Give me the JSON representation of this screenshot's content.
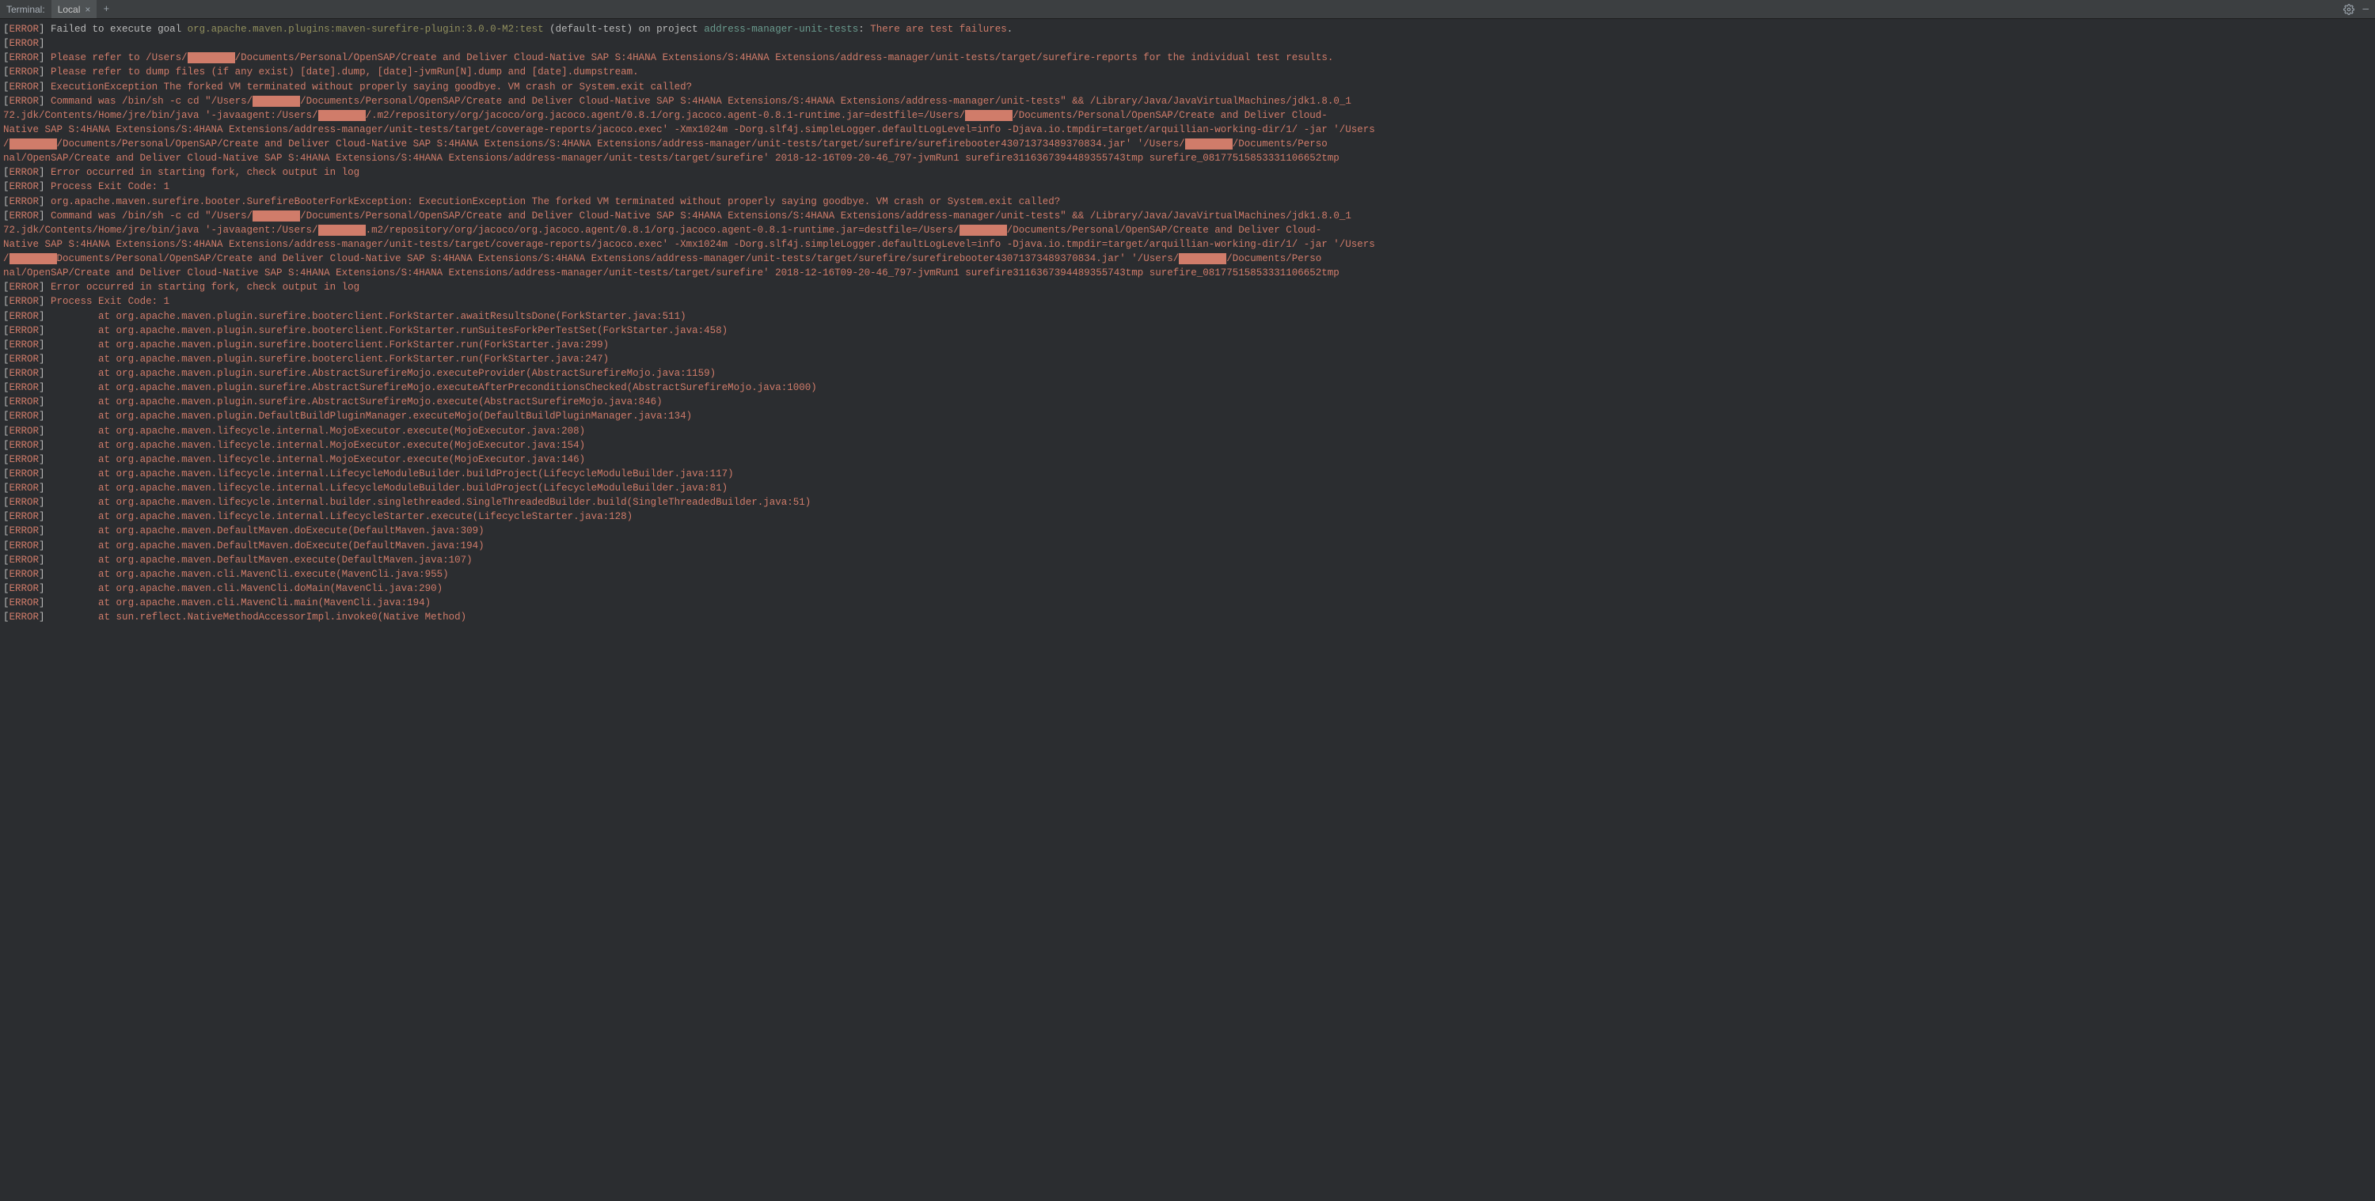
{
  "header": {
    "title": "Terminal:",
    "tab_label": "Local",
    "close_glyph": "×",
    "plus_glyph": "+",
    "gear_glyph": "⚙",
    "minimize_glyph": "—"
  },
  "error_tag": "ERROR",
  "redacted": "████████",
  "lines": [
    {
      "type": "mixed_goal",
      "pre": "Failed to execute goal ",
      "goal": "org.apache.maven.plugins:maven-surefire-plugin:3.0.0-M2:test",
      "mid": " (default-test) on project ",
      "project": "address-manager-unit-tests",
      "post1": ": ",
      "fail": "There are test failures",
      "dot": "."
    },
    {
      "type": "blank_error"
    },
    {
      "type": "refer_path",
      "pre": "Please refer to /Users/",
      "post": "/Documents/Personal/OpenSAP/Create and Deliver Cloud-Native SAP S:4HANA Extensions/S:4HANA Extensions/address-manager/unit-tests/target/surefire-reports for the individual test results."
    },
    {
      "type": "salmon_plain",
      "text": "Please refer to dump files (if any exist) [date].dump, [date]-jvmRun[N].dump and [date].dumpstream."
    },
    {
      "type": "salmon_plain",
      "text": "ExecutionException The forked VM terminated without properly saying goodbye. VM crash or System.exit called?"
    },
    {
      "type": "command_block",
      "part0_pre": "Command was /bin/sh -c cd \"/Users/",
      "part0_post": "/Documents/Personal/OpenSAP/Create and Deliver Cloud-Native SAP S:4HANA Extensions/S:4HANA Extensions/address-manager/unit-tests\" && /Library/Java/JavaVirtualMachines/jdk1.8.0_1",
      "part1_pre": "72.jdk/Contents/Home/jre/bin/java '-javaagent:/Users/",
      "part1_mid": "/.m2/repository/org/jacoco/org.jacoco.agent/0.8.1/org.jacoco.agent-0.8.1-runtime.jar=destfile=/Users/",
      "part1_post": "/Documents/Personal/OpenSAP/Create and Deliver Cloud-",
      "part2": "Native SAP S:4HANA Extensions/S:4HANA Extensions/address-manager/unit-tests/target/coverage-reports/jacoco.exec' -Xmx1024m -Dorg.slf4j.simpleLogger.defaultLogLevel=info -Djava.io.tmpdir=target/arquillian-working-dir/1/ -jar '/Users",
      "part3_pre": "/",
      "part3_mid": "/Documents/Personal/OpenSAP/Create and Deliver Cloud-Native SAP S:4HANA Extensions/S:4HANA Extensions/address-manager/unit-tests/target/surefire/surefirebooter43071373489370834.jar' '/Users/",
      "part3_post": "/Documents/Perso",
      "part4": "nal/OpenSAP/Create and Deliver Cloud-Native SAP S:4HANA Extensions/S:4HANA Extensions/address-manager/unit-tests/target/surefire' 2018-12-16T09-20-46_797-jvmRun1 surefire3116367394489355743tmp surefire_08177515853331106652tmp"
    },
    {
      "type": "salmon_plain",
      "text": "Error occurred in starting fork, check output in log"
    },
    {
      "type": "salmon_plain",
      "text": "Process Exit Code: 1"
    },
    {
      "type": "salmon_plain",
      "text": "org.apache.maven.surefire.booter.SurefireBooterForkException: ExecutionException The forked VM terminated without properly saying goodbye. VM crash or System.exit called?"
    },
    {
      "type": "command_block",
      "part0_pre": "Command was /bin/sh -c cd \"/Users/",
      "part0_post": "/Documents/Personal/OpenSAP/Create and Deliver Cloud-Native SAP S:4HANA Extensions/S:4HANA Extensions/address-manager/unit-tests\" && /Library/Java/JavaVirtualMachines/jdk1.8.0_1",
      "part1_pre": "72.jdk/Contents/Home/jre/bin/java '-javaagent:/Users/",
      "part1_mid": ".m2/repository/org/jacoco/org.jacoco.agent/0.8.1/org.jacoco.agent-0.8.1-runtime.jar=destfile=/Users/",
      "part1_post": "/Documents/Personal/OpenSAP/Create and Deliver Cloud-",
      "part2": "Native SAP S:4HANA Extensions/S:4HANA Extensions/address-manager/unit-tests/target/coverage-reports/jacoco.exec' -Xmx1024m -Dorg.slf4j.simpleLogger.defaultLogLevel=info -Djava.io.tmpdir=target/arquillian-working-dir/1/ -jar '/Users",
      "part3_pre": "/",
      "part3_mid": "Documents/Personal/OpenSAP/Create and Deliver Cloud-Native SAP S:4HANA Extensions/S:4HANA Extensions/address-manager/unit-tests/target/surefire/surefirebooter43071373489370834.jar' '/Users/",
      "part3_post": "/Documents/Perso",
      "part4": "nal/OpenSAP/Create and Deliver Cloud-Native SAP S:4HANA Extensions/S:4HANA Extensions/address-manager/unit-tests/target/surefire' 2018-12-16T09-20-46_797-jvmRun1 surefire3116367394489355743tmp surefire_08177515853331106652tmp"
    },
    {
      "type": "salmon_plain",
      "text": "Error occurred in starting fork, check output in log"
    },
    {
      "type": "salmon_plain",
      "text": "Process Exit Code: 1"
    },
    {
      "type": "trace",
      "text": "        at org.apache.maven.plugin.surefire.booterclient.ForkStarter.awaitResultsDone(ForkStarter.java:511)"
    },
    {
      "type": "trace",
      "text": "        at org.apache.maven.plugin.surefire.booterclient.ForkStarter.runSuitesForkPerTestSet(ForkStarter.java:458)"
    },
    {
      "type": "trace",
      "text": "        at org.apache.maven.plugin.surefire.booterclient.ForkStarter.run(ForkStarter.java:299)"
    },
    {
      "type": "trace",
      "text": "        at org.apache.maven.plugin.surefire.booterclient.ForkStarter.run(ForkStarter.java:247)"
    },
    {
      "type": "trace",
      "text": "        at org.apache.maven.plugin.surefire.AbstractSurefireMojo.executeProvider(AbstractSurefireMojo.java:1159)"
    },
    {
      "type": "trace",
      "text": "        at org.apache.maven.plugin.surefire.AbstractSurefireMojo.executeAfterPreconditionsChecked(AbstractSurefireMojo.java:1000)"
    },
    {
      "type": "trace",
      "text": "        at org.apache.maven.plugin.surefire.AbstractSurefireMojo.execute(AbstractSurefireMojo.java:846)"
    },
    {
      "type": "trace",
      "text": "        at org.apache.maven.plugin.DefaultBuildPluginManager.executeMojo(DefaultBuildPluginManager.java:134)"
    },
    {
      "type": "trace",
      "text": "        at org.apache.maven.lifecycle.internal.MojoExecutor.execute(MojoExecutor.java:208)"
    },
    {
      "type": "trace",
      "text": "        at org.apache.maven.lifecycle.internal.MojoExecutor.execute(MojoExecutor.java:154)"
    },
    {
      "type": "trace",
      "text": "        at org.apache.maven.lifecycle.internal.MojoExecutor.execute(MojoExecutor.java:146)"
    },
    {
      "type": "trace",
      "text": "        at org.apache.maven.lifecycle.internal.LifecycleModuleBuilder.buildProject(LifecycleModuleBuilder.java:117)"
    },
    {
      "type": "trace",
      "text": "        at org.apache.maven.lifecycle.internal.LifecycleModuleBuilder.buildProject(LifecycleModuleBuilder.java:81)"
    },
    {
      "type": "trace",
      "text": "        at org.apache.maven.lifecycle.internal.builder.singlethreaded.SingleThreadedBuilder.build(SingleThreadedBuilder.java:51)"
    },
    {
      "type": "trace",
      "text": "        at org.apache.maven.lifecycle.internal.LifecycleStarter.execute(LifecycleStarter.java:128)"
    },
    {
      "type": "trace",
      "text": "        at org.apache.maven.DefaultMaven.doExecute(DefaultMaven.java:309)"
    },
    {
      "type": "trace",
      "text": "        at org.apache.maven.DefaultMaven.doExecute(DefaultMaven.java:194)"
    },
    {
      "type": "trace",
      "text": "        at org.apache.maven.DefaultMaven.execute(DefaultMaven.java:107)"
    },
    {
      "type": "trace",
      "text": "        at org.apache.maven.cli.MavenCli.execute(MavenCli.java:955)"
    },
    {
      "type": "trace",
      "text": "        at org.apache.maven.cli.MavenCli.doMain(MavenCli.java:290)"
    },
    {
      "type": "trace",
      "text": "        at org.apache.maven.cli.MavenCli.main(MavenCli.java:194)"
    },
    {
      "type": "trace",
      "text": "        at sun.reflect.NativeMethodAccessorImpl.invoke0(Native Method)"
    }
  ]
}
